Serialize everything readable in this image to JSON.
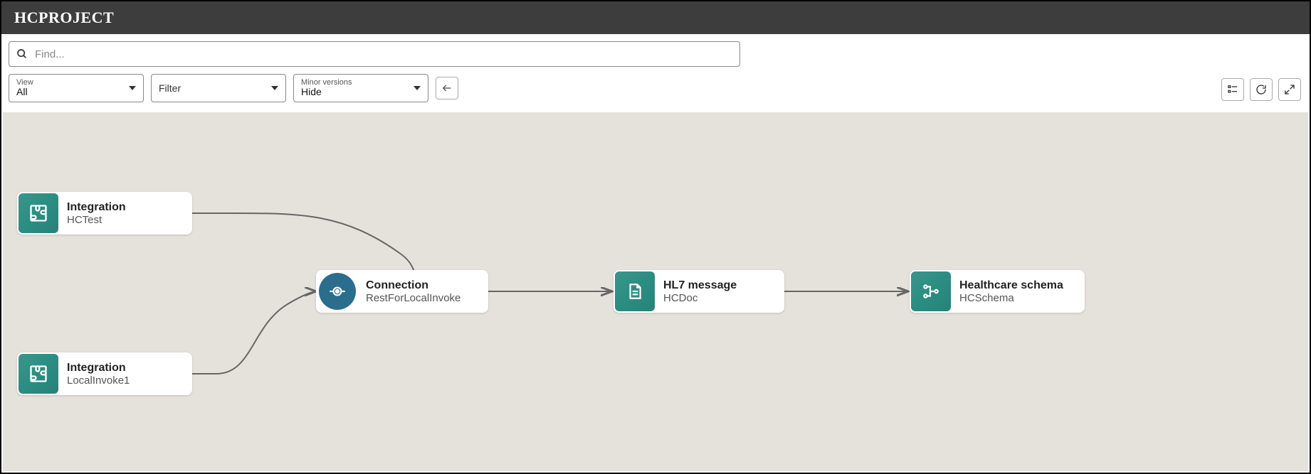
{
  "header": {
    "title": "HCPROJECT"
  },
  "search": {
    "placeholder": "Find..."
  },
  "dropdowns": {
    "view": {
      "label": "View",
      "value": "All"
    },
    "filter": {
      "label": "Filter"
    },
    "minor": {
      "label": "Minor versions",
      "value": "Hide"
    }
  },
  "nodes": {
    "n1": {
      "type": "Integration",
      "name": "HCTest"
    },
    "n2": {
      "type": "Integration",
      "name": "LocalInvoke1"
    },
    "n3": {
      "type": "Connection",
      "name": "RestForLocalInvoke"
    },
    "n4": {
      "type": "HL7 message",
      "name": "HCDoc"
    },
    "n5": {
      "type": "Healthcare schema",
      "name": "HCSchema"
    }
  }
}
